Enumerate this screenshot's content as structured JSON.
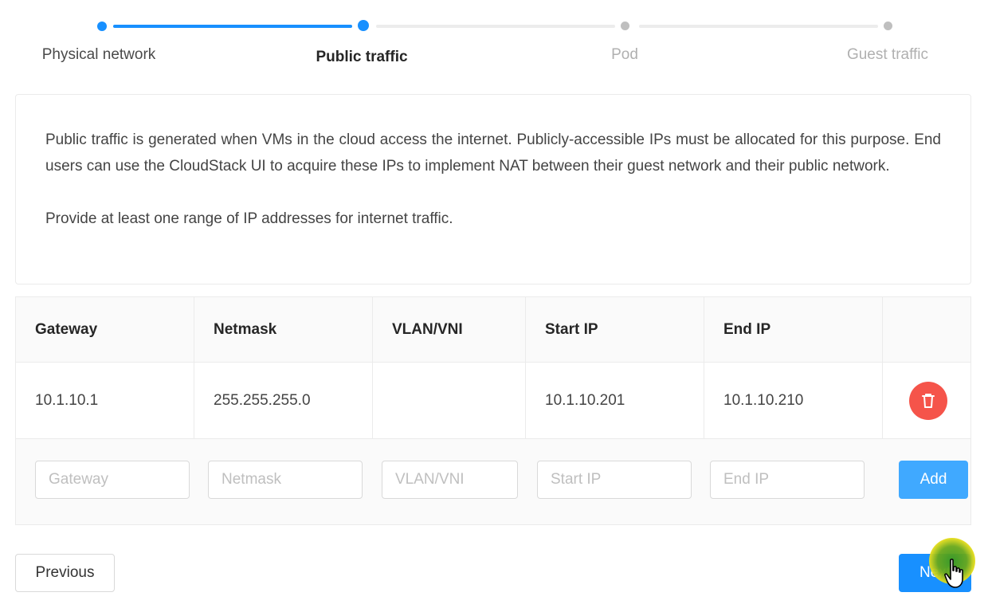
{
  "steps": [
    {
      "label": "Physical network",
      "state": "done"
    },
    {
      "label": "Public traffic",
      "state": "current"
    },
    {
      "label": "Pod",
      "state": "pending"
    },
    {
      "label": "Guest traffic",
      "state": "pending"
    }
  ],
  "description": {
    "paragraph1": "Public traffic is generated when VMs in the cloud access the internet. Publicly-accessible IPs must be allocated for this purpose. End users can use the CloudStack UI to acquire these IPs to implement NAT between their guest network and their public network.",
    "paragraph2": "Provide at least one range of IP addresses for internet traffic."
  },
  "table": {
    "headers": [
      "Gateway",
      "Netmask",
      "VLAN/VNI",
      "Start IP",
      "End IP",
      ""
    ],
    "rows": [
      {
        "gateway": "10.1.10.1",
        "netmask": "255.255.255.0",
        "vlan": "",
        "start_ip": "10.1.10.201",
        "end_ip": "10.1.10.210",
        "action_icon": "trash-icon"
      }
    ],
    "inputs": {
      "gateway_placeholder": "Gateway",
      "netmask_placeholder": "Netmask",
      "vlan_placeholder": "VLAN/VNI",
      "start_ip_placeholder": "Start IP",
      "end_ip_placeholder": "End IP",
      "add_label": "Add"
    }
  },
  "footer": {
    "previous_label": "Previous",
    "next_label": "Next"
  },
  "colors": {
    "primary": "#1890ff",
    "add_button": "#40a9ff",
    "delete_button": "#f5544a",
    "inactive_step": "#bfbfbf"
  }
}
